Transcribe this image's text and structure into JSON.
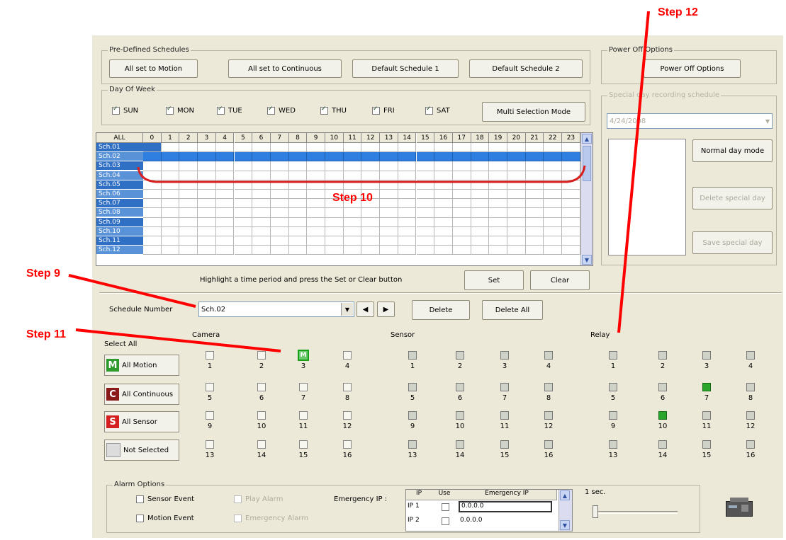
{
  "predefined": {
    "title": "Pre-Defined Schedules",
    "buttons": [
      "All set to Motion",
      "All set to Continuous",
      "Default Schedule 1",
      "Default Schedule 2"
    ]
  },
  "power_off": {
    "title": "Power Off Options",
    "button": "Power Off Options"
  },
  "day_of_week": {
    "title": "Day Of Week",
    "days": [
      {
        "label": "SUN",
        "checked": true
      },
      {
        "label": "MON",
        "checked": true
      },
      {
        "label": "TUE",
        "checked": true
      },
      {
        "label": "WED",
        "checked": true
      },
      {
        "label": "THU",
        "checked": true
      },
      {
        "label": "FRI",
        "checked": true
      },
      {
        "label": "SAT",
        "checked": true
      }
    ],
    "multi_mode": "Multi Selection Mode"
  },
  "special_day": {
    "title": "Special day recording schedule",
    "date": "4/24/2008",
    "normal_day": "Normal day mode",
    "delete": "Delete special day",
    "save": "Save special day"
  },
  "grid": {
    "all_label": "ALL",
    "hours": [
      "0",
      "1",
      "2",
      "3",
      "4",
      "5",
      "6",
      "7",
      "8",
      "9",
      "10",
      "11",
      "12",
      "13",
      "14",
      "15",
      "16",
      "17",
      "18",
      "19",
      "20",
      "21",
      "22",
      "23"
    ],
    "schedules": [
      "Sch.01",
      "Sch.02",
      "Sch.03",
      "Sch.04",
      "Sch.05",
      "Sch.06",
      "Sch.07",
      "Sch.08",
      "Sch.09",
      "Sch.10",
      "Sch.11",
      "Sch.12"
    ],
    "hint": "Highlight a time period and press the Set or Clear button",
    "set": "Set",
    "clear": "Clear"
  },
  "schedule_number": {
    "label": "Schedule Number",
    "value": "Sch.02",
    "delete": "Delete",
    "delete_all": "Delete All"
  },
  "io": {
    "camera_label": "Camera",
    "sensor_label": "Sensor",
    "relay_label": "Relay",
    "numbers": [
      "1",
      "2",
      "3",
      "4",
      "5",
      "6",
      "7",
      "8",
      "9",
      "10",
      "11",
      "12",
      "13",
      "14",
      "15",
      "16"
    ]
  },
  "select_all": {
    "title": "Select All",
    "buttons": [
      {
        "icon": "M",
        "label": "All Motion",
        "color": "#2e9a2e"
      },
      {
        "icon": "C",
        "label": "All Continuous",
        "color": "#8a1a1a"
      },
      {
        "icon": "S",
        "label": "All Sensor",
        "color": "#d42020"
      },
      {
        "icon": "",
        "label": "Not Selected",
        "color": "#dcdcdc"
      }
    ]
  },
  "alarm": {
    "title": "Alarm Options",
    "sensor_event": "Sensor Event",
    "motion_event": "Motion Event",
    "play_alarm": "Play Alarm",
    "emergency_alarm": "Emergency Alarm",
    "emergency_ip_label": "Emergency IP :",
    "table_headers": [
      "IP",
      "Use",
      "Emergency IP"
    ],
    "rows": [
      {
        "ip": "IP 1",
        "value": "0.0.0.0"
      },
      {
        "ip": "IP 2",
        "value": "0.0.0.0"
      }
    ],
    "slider_label": "1 sec."
  },
  "annotations": {
    "step9": "Step 9",
    "step10": "Step 10",
    "step11": "Step 11",
    "step12": "Step 12"
  },
  "colors": {
    "annotation": "#ff0000",
    "selection": "#2f6fc4",
    "motion": "#2e9a2e"
  }
}
